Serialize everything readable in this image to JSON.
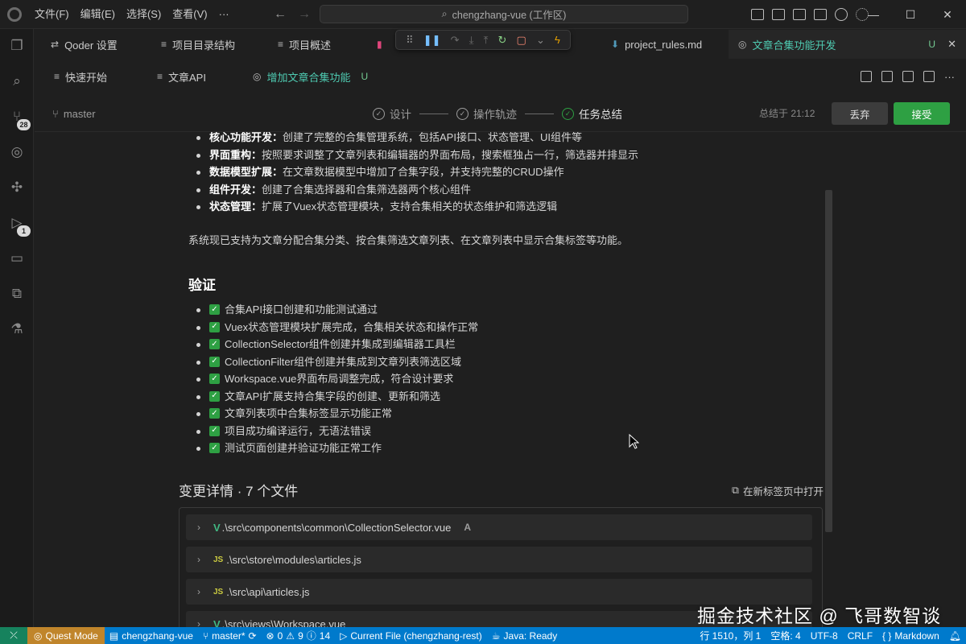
{
  "titlebar": {
    "menu": [
      "文件(F)",
      "编辑(E)",
      "选择(S)",
      "查看(V)",
      "···"
    ],
    "search_text": "chengzhang-vue (工作区)"
  },
  "activity": {
    "source_control_badge": "28",
    "run_badge": "1"
  },
  "tabs_row1": {
    "qoder_settings": "Qoder 设置",
    "project_structure": "项目目录结构",
    "project_overview": "项目概述",
    "project_rules": "project_rules.md",
    "feature_dev": "文章合集功能开发",
    "feature_dev_mark": "U"
  },
  "tabs_row2": {
    "quick_start": "快速开始",
    "article_api": "文章API",
    "add_feature": "增加文章合集功能",
    "add_feature_mark": "U"
  },
  "stepbar": {
    "branch": "master",
    "steps": [
      "设计",
      "操作轨迹",
      "任务总结"
    ],
    "summary_time": "总结于 21:12",
    "discard_label": "丢弃",
    "accept_label": "接受"
  },
  "content": {
    "bullets": [
      {
        "bold": "核心功能开发：",
        "text": "创建了完整的合集管理系统，包括API接口、状态管理、UI组件等"
      },
      {
        "bold": "界面重构：",
        "text": "按照要求调整了文章列表和编辑器的界面布局，搜索框独占一行，筛选器并排显示"
      },
      {
        "bold": "数据模型扩展：",
        "text": "在文章数据模型中增加了合集字段，并支持完整的CRUD操作"
      },
      {
        "bold": "组件开发：",
        "text": "创建了合集选择器和合集筛选器两个核心组件"
      },
      {
        "bold": "状态管理：",
        "text": "扩展了Vuex状态管理模块，支持合集相关的状态维护和筛选逻辑"
      }
    ],
    "paragraph": "系统现已支持为文章分配合集分类、按合集筛选文章列表、在文章列表中显示合集标签等功能。",
    "verify_heading": "验证",
    "checks": [
      "合集API接口创建和功能测试通过",
      "Vuex状态管理模块扩展完成，合集相关状态和操作正常",
      "CollectionSelector组件创建并集成到编辑器工具栏",
      "CollectionFilter组件创建并集成到文章列表筛选区域",
      "Workspace.vue界面布局调整完成，符合设计要求",
      "文章API扩展支持合集字段的创建、更新和筛选",
      "文章列表项中合集标签显示功能正常",
      "项目成功编译运行，无语法错误",
      "测试页面创建并验证功能正常工作"
    ],
    "changes_title": "变更详情 · 7 个文件",
    "open_new_tab": "在新标签页中打开",
    "files": [
      {
        "icon": "vue",
        "path": ".\\src\\components\\common\\CollectionSelector.vue",
        "status": "A"
      },
      {
        "icon": "js",
        "path": ".\\src\\store\\modules\\articles.js",
        "status": ""
      },
      {
        "icon": "js",
        "path": ".\\src\\api\\articles.js",
        "status": ""
      },
      {
        "icon": "vue",
        "path": ".\\src\\views\\Workspace.vue",
        "status": ""
      }
    ]
  },
  "watermark": "掘金技术社区 @ 飞哥数智谈",
  "statusbar": {
    "quest_mode": "Quest Mode",
    "workspace": "chengzhang-vue",
    "branch": "master*",
    "errors": "0",
    "warnings": "9",
    "infos": "14",
    "current_file": "Current File (chengzhang-rest)",
    "java": "Java: Ready",
    "position": "行 1510，列 1",
    "spaces": "空格: 4",
    "encoding": "UTF-8",
    "eol": "CRLF",
    "language": "Markdown"
  }
}
